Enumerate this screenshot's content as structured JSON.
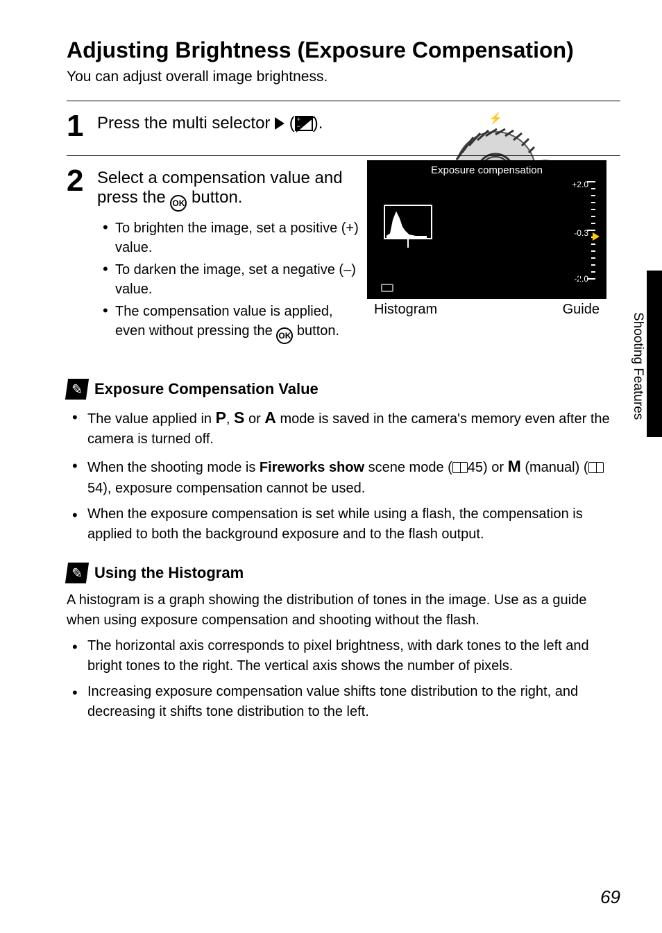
{
  "title": "Adjusting Brightness (Exposure Compensation)",
  "intro": "You can adjust overall image brightness.",
  "sideTab": "Shooting Features",
  "pageNumber": "69",
  "step1": {
    "num": "1",
    "instruction_pre": "Press the multi selector ",
    "instruction_post": "."
  },
  "step2": {
    "num": "2",
    "instruction_pre": "Select a compensation value and press the ",
    "instruction_post": " button.",
    "bullets": {
      "b1": "To brighten the image, set a positive (+) value.",
      "b2": "To darken the image, set a negative (–) value.",
      "b3_pre": "The compensation value is applied, even without pressing the ",
      "b3_post": " button."
    }
  },
  "lcd": {
    "title": "Exposure compensation",
    "top": "+2.0",
    "mid": "-0.3",
    "bot": "-2.0",
    "labelHistogram": "Histogram",
    "labelGuide": "Guide"
  },
  "note1": {
    "title": "Exposure Compensation Value",
    "li1_pre": "The value applied in ",
    "li1_mid": " mode is saved in the camera's memory even after the camera is turned off.",
    "li2_pre": "When the shooting mode is ",
    "li2_fireworks": "Fireworks show",
    "li2_scene": " scene mode (",
    "li2_ref1": "45) or ",
    "li2_manual": " (manual) (",
    "li2_ref2": "54), exposure compensation cannot be used.",
    "li3": "When the exposure compensation is set while using a flash, the compensation is applied to both the background exposure and to the flash output.",
    "modes": {
      "P": "P",
      "S": "S",
      "A": "A",
      "M": "M"
    }
  },
  "note2": {
    "title": "Using the Histogram",
    "para": "A histogram is a graph showing the distribution of tones in the image. Use as a guide when using exposure compensation and shooting without the flash.",
    "li1": "The horizontal axis corresponds to pixel brightness, with dark tones to the left and bright tones to the right. The vertical axis shows the number of pixels.",
    "li2": "Increasing exposure compensation value shifts tone distribution to the right, and decreasing it shifts tone distribution to the left."
  }
}
